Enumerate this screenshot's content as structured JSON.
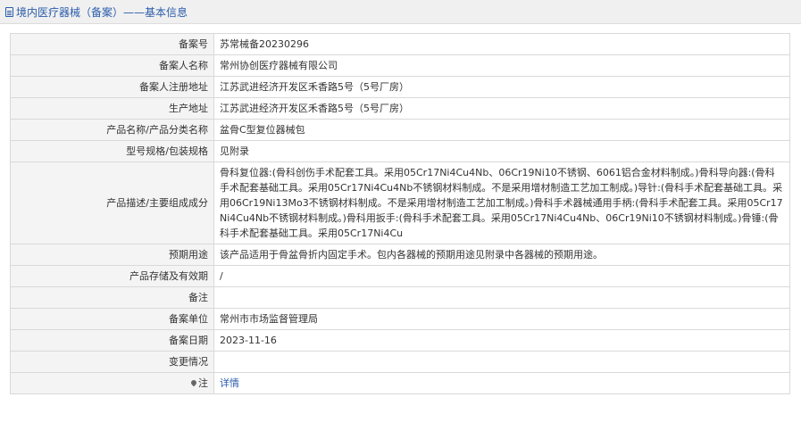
{
  "header": {
    "title": "境内医疗器械（备案）——基本信息"
  },
  "rows": [
    {
      "label": "备案号",
      "value": "苏常械备20230296"
    },
    {
      "label": "备案人名称",
      "value": "常州协创医疗器械有限公司"
    },
    {
      "label": "备案人注册地址",
      "value": "江苏武进经济开发区禾香路5号（5号厂房）"
    },
    {
      "label": "生产地址",
      "value": "江苏武进经济开发区禾香路5号（5号厂房）"
    },
    {
      "label": "产品名称/产品分类名称",
      "value": "盆骨C型复位器械包"
    },
    {
      "label": "型号规格/包装规格",
      "value": "见附录"
    },
    {
      "label": "产品描述/主要组成成分",
      "value": "骨科复位器:(骨科创伤手术配套工具。采用05Cr17Ni4Cu4Nb、06Cr19Ni10不锈钢、6061铝合金材料制成。)骨科导向器:(骨科手术配套基础工具。采用05Cr17Ni4Cu4Nb不锈钢材料制成。不是采用增材制造工艺加工制成。)导针:(骨科手术配套基础工具。采用06Cr19Ni13Mo3不锈钢材料制成。不是采用增材制造工艺加工制成。)骨科手术器械通用手柄:(骨科手术配套工具。采用05Cr17Ni4Cu4Nb不锈钢材料制成。)骨科用扳手:(骨科手术配套工具。采用05Cr17Ni4Cu4Nb、06Cr19Ni10不锈钢材料制成。)骨锤:(骨科手术配套基础工具。采用05Cr17Ni4Cu"
    },
    {
      "label": "预期用途",
      "value": "该产品适用于骨盆骨折内固定手术。包内各器械的预期用途见附录中各器械的预期用途。"
    },
    {
      "label": "产品存储及有效期",
      "value": "/"
    },
    {
      "label": "备注",
      "value": ""
    },
    {
      "label": "备案单位",
      "value": "常州市市场监督管理局"
    },
    {
      "label": "备案日期",
      "value": "2023-11-16"
    },
    {
      "label": "变更情况",
      "value": ""
    }
  ],
  "note": {
    "label": "注",
    "link_text": "详情",
    "icon": "pin-icon"
  }
}
